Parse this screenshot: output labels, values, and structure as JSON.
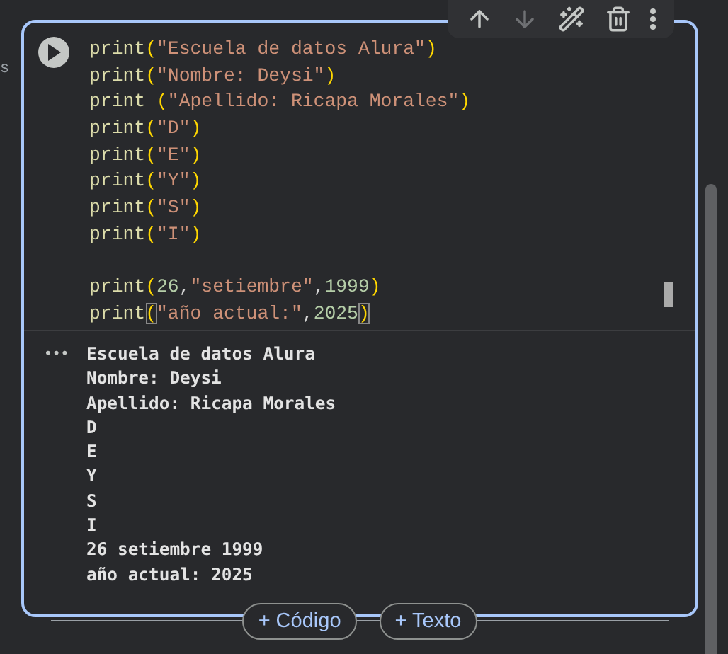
{
  "gutter": {
    "exec_time": "s"
  },
  "toolbar": [
    {
      "kind": "up",
      "disabled": false
    },
    {
      "kind": "down",
      "disabled": true
    },
    {
      "kind": "wand",
      "disabled": false
    },
    {
      "kind": "trash",
      "disabled": false
    },
    {
      "kind": "more",
      "disabled": false
    }
  ],
  "code_lines": [
    [
      {
        "kind": "func",
        "text": "print"
      },
      {
        "kind": "paren",
        "text": "("
      },
      {
        "kind": "string",
        "text": "\"Escuela de datos Alura\""
      },
      {
        "kind": "paren",
        "text": ")"
      }
    ],
    [
      {
        "kind": "func",
        "text": "print"
      },
      {
        "kind": "paren",
        "text": "("
      },
      {
        "kind": "string",
        "text": "\"Nombre: Deysi\""
      },
      {
        "kind": "paren",
        "text": ")"
      }
    ],
    [
      {
        "kind": "func",
        "text": "print "
      },
      {
        "kind": "paren",
        "text": "("
      },
      {
        "kind": "string",
        "text": "\"Apellido: Ricapa Morales\""
      },
      {
        "kind": "paren",
        "text": ")"
      }
    ],
    [
      {
        "kind": "func",
        "text": "print"
      },
      {
        "kind": "paren",
        "text": "("
      },
      {
        "kind": "string",
        "text": "\"D\""
      },
      {
        "kind": "paren",
        "text": ")"
      }
    ],
    [
      {
        "kind": "func",
        "text": "print"
      },
      {
        "kind": "paren",
        "text": "("
      },
      {
        "kind": "string",
        "text": "\"E\""
      },
      {
        "kind": "paren",
        "text": ")"
      }
    ],
    [
      {
        "kind": "func",
        "text": "print"
      },
      {
        "kind": "paren",
        "text": "("
      },
      {
        "kind": "string",
        "text": "\"Y\""
      },
      {
        "kind": "paren",
        "text": ")"
      }
    ],
    [
      {
        "kind": "func",
        "text": "print"
      },
      {
        "kind": "paren",
        "text": "("
      },
      {
        "kind": "string",
        "text": "\"S\""
      },
      {
        "kind": "paren",
        "text": ")"
      }
    ],
    [
      {
        "kind": "func",
        "text": "print"
      },
      {
        "kind": "paren",
        "text": "("
      },
      {
        "kind": "string",
        "text": "\"I\""
      },
      {
        "kind": "paren",
        "text": ")"
      }
    ],
    [
      {
        "kind": "gap"
      },
      {
        "kind": "func",
        "text": "print"
      },
      {
        "kind": "paren",
        "text": "("
      },
      {
        "kind": "number",
        "text": "26"
      },
      {
        "kind": "plain",
        "text": ","
      },
      {
        "kind": "string",
        "text": "\"setiembre\""
      },
      {
        "kind": "plain",
        "text": ","
      },
      {
        "kind": "number",
        "text": "1999"
      },
      {
        "kind": "paren",
        "text": ")"
      }
    ],
    [
      {
        "kind": "func",
        "text": "print"
      },
      {
        "kind": "match",
        "text": "("
      },
      {
        "kind": "string",
        "text": "\"año actual:\""
      },
      {
        "kind": "plain",
        "text": ","
      },
      {
        "kind": "number",
        "text": "2025"
      },
      {
        "kind": "match",
        "text": ")"
      }
    ]
  ],
  "output_marker": "•••",
  "output_lines": [
    "Escuela de datos Alura",
    "Nombre: Deysi",
    "Apellido: Ricapa Morales",
    "D",
    "E",
    "Y",
    "S",
    "I",
    "26 setiembre 1999",
    "año actual: 2025"
  ],
  "add_buttons": [
    "+ Código",
    "+ Texto"
  ]
}
